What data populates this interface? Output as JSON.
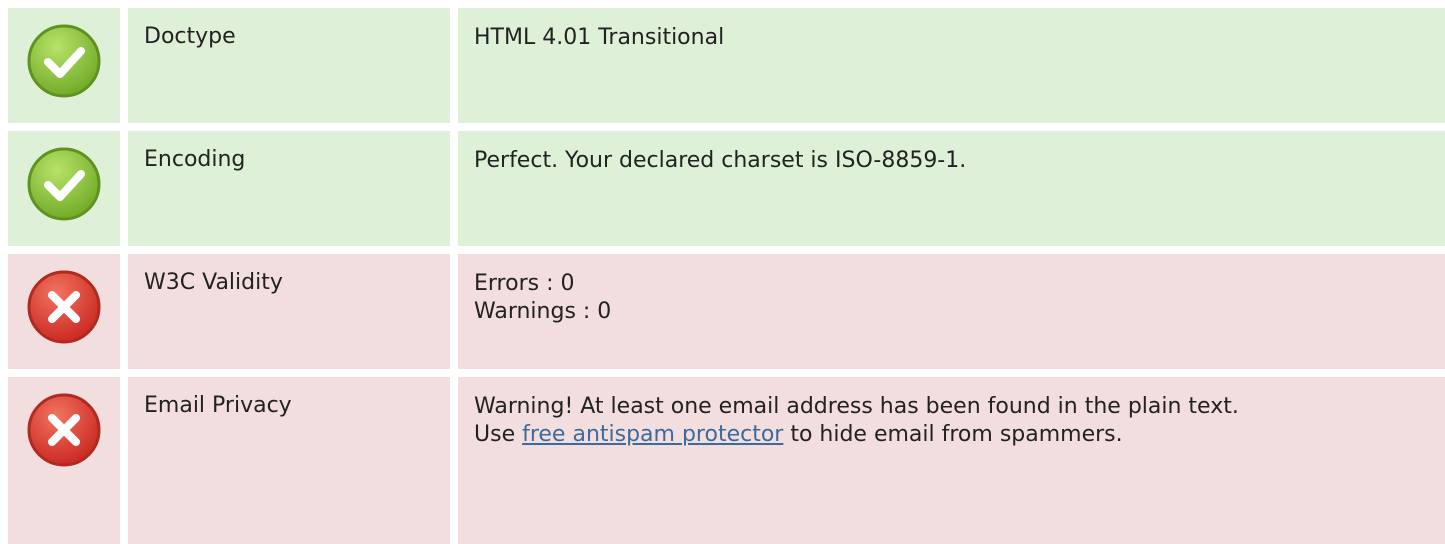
{
  "rows": [
    {
      "status": "pass",
      "icon": "check-circle-icon",
      "label": "Doctype",
      "value": "HTML 4.01 Transitional"
    },
    {
      "status": "pass",
      "icon": "check-circle-icon",
      "label": "Encoding",
      "value": "Perfect. Your declared charset is ISO-8859-1."
    },
    {
      "status": "fail",
      "icon": "x-circle-icon",
      "label": "W3C Validity",
      "lines": [
        "Errors : 0",
        "Warnings : 0"
      ]
    },
    {
      "status": "fail",
      "icon": "x-circle-icon",
      "label": "Email Privacy",
      "line1": "Warning! At least one email address has been found in the plain text.",
      "line2_prefix": "Use ",
      "line2_link": "free antispam protector",
      "line2_suffix": " to hide email from spammers."
    }
  ],
  "colors": {
    "pass_bg": "#dff0d8",
    "fail_bg": "#f2dede",
    "pass_icon": "#8cc13f",
    "fail_icon": "#e03b36",
    "link": "#3c6a9c"
  }
}
